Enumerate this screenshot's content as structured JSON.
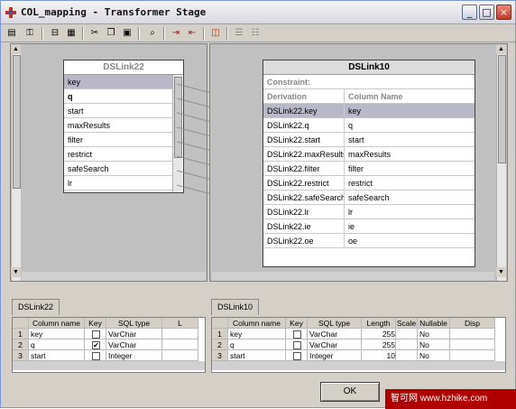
{
  "window": {
    "title": "COL_mapping - Transformer Stage",
    "minimize": "_",
    "maximize": "□",
    "close": "×"
  },
  "toolbar": {
    "icons": [
      "stage-properties-icon",
      "link-icon",
      "column-icon",
      "cut-icon",
      "copy-icon",
      "paste-icon",
      "find-icon",
      "input-link-icon",
      "output-link-icon",
      "routine-icon",
      "load-columns-icon",
      "save-columns-icon"
    ]
  },
  "input_link": {
    "name": "DSLink22",
    "columns": [
      "key",
      "q",
      "start",
      "maxResults",
      "filter",
      "restrict",
      "safeSearch",
      "lr"
    ]
  },
  "output_link": {
    "name": "DSLink10",
    "constraint_label": "Constraint:",
    "header_derivation": "Derivation",
    "header_column": "Column Name",
    "rows": [
      {
        "derivation": "DSLink22.key",
        "column": "key"
      },
      {
        "derivation": "DSLink22.q",
        "column": "q"
      },
      {
        "derivation": "DSLink22.start",
        "column": "start"
      },
      {
        "derivation": "DSLink22.maxResults",
        "column": "maxResults"
      },
      {
        "derivation": "DSLink22.filter",
        "column": "filter"
      },
      {
        "derivation": "DSLink22.restrict",
        "column": "restrict"
      },
      {
        "derivation": "DSLink22.safeSearch",
        "column": "safeSearch"
      },
      {
        "derivation": "DSLink22.lr",
        "column": "lr"
      },
      {
        "derivation": "DSLink22.ie",
        "column": "ie"
      },
      {
        "derivation": "DSLink22.oe",
        "column": "oe"
      }
    ]
  },
  "left_grid": {
    "tab": "DSLink22",
    "headers": [
      "",
      "Column name",
      "Key",
      "SQL type",
      "L"
    ],
    "rows": [
      [
        "1",
        "key",
        "",
        "VarChar"
      ],
      [
        "2",
        "q",
        "✔",
        "VarChar"
      ],
      [
        "3",
        "start",
        "",
        "Integer"
      ]
    ]
  },
  "right_grid": {
    "tab": "DSLink10",
    "headers": [
      "",
      "Column name",
      "Key",
      "SQL type",
      "Length",
      "Scale",
      "Nullable",
      "Disp"
    ],
    "rows": [
      [
        "1",
        "key",
        "",
        "VarChar",
        "255",
        "",
        "No"
      ],
      [
        "2",
        "q",
        "",
        "VarChar",
        "255",
        "",
        "No"
      ],
      [
        "3",
        "start",
        "",
        "Integer",
        "10",
        "",
        "No"
      ]
    ]
  },
  "buttons": {
    "ok": "OK"
  },
  "watermark": "智可网 www.hzhike.com",
  "colors": {
    "selected": "#b8b8c8"
  }
}
